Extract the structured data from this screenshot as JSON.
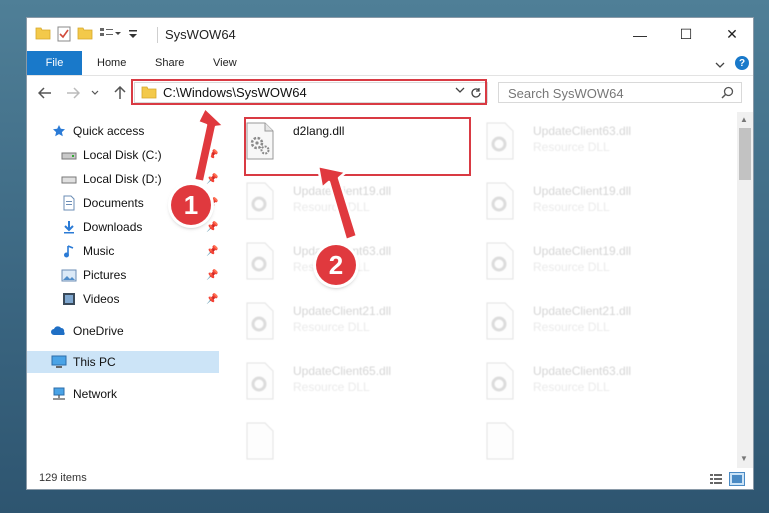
{
  "window": {
    "title": "SysWOW64",
    "controls": {
      "minimize": "—",
      "maximize": "☐",
      "close": "✕"
    }
  },
  "ribbon": {
    "tabs": [
      {
        "label": "File"
      },
      {
        "label": "Home"
      },
      {
        "label": "Share"
      },
      {
        "label": "View"
      }
    ],
    "help": "?"
  },
  "navigation": {
    "address": "C:\\Windows\\SysWOW64",
    "search_placeholder": "Search SysWOW64"
  },
  "sidebar": {
    "items": [
      {
        "label": "Quick access",
        "icon": "star-icon"
      },
      {
        "label": "Local Disk (C:)",
        "icon": "drive-icon",
        "pinned": true
      },
      {
        "label": "Local Disk (D:)",
        "icon": "drive-icon",
        "pinned": true
      },
      {
        "label": "Documents",
        "icon": "documents-icon",
        "pinned": true
      },
      {
        "label": "Downloads",
        "icon": "downloads-icon",
        "pinned": true
      },
      {
        "label": "Music",
        "icon": "music-icon",
        "pinned": true
      },
      {
        "label": "Pictures",
        "icon": "pictures-icon",
        "pinned": true
      },
      {
        "label": "Videos",
        "icon": "videos-icon",
        "pinned": true
      },
      {
        "label": "OneDrive",
        "icon": "onedrive-icon"
      },
      {
        "label": "This PC",
        "icon": "this-pc-icon",
        "selected": true
      },
      {
        "label": "Network",
        "icon": "network-icon"
      }
    ]
  },
  "files": {
    "highlighted": {
      "name": "d2lang.dll"
    },
    "faded": [
      {
        "name": "UpdateClient63.dll",
        "type": "Resource DLL"
      },
      {
        "name": "UpdateClient19.dll",
        "type": "Resource DLL"
      },
      {
        "name": "UpdateClient19.dll",
        "type": "Resource DLL"
      },
      {
        "name": "UpdateClient63.dll",
        "type": "Resource DLL"
      },
      {
        "name": "UpdateClient19.dll",
        "type": "Resource DLL"
      },
      {
        "name": "UpdateClient21.dll",
        "type": "Resource DLL"
      },
      {
        "name": "UpdateClient21.dll",
        "type": "Resource DLL"
      },
      {
        "name": "UpdateClient65.dll",
        "type": "Resource DLL"
      },
      {
        "name": "UpdateClient63.dll",
        "type": "Resource DLL"
      }
    ]
  },
  "status": {
    "item_count": "129 items"
  },
  "annotations": {
    "badge_1": "1",
    "badge_2": "2",
    "color": "#e0393e"
  }
}
